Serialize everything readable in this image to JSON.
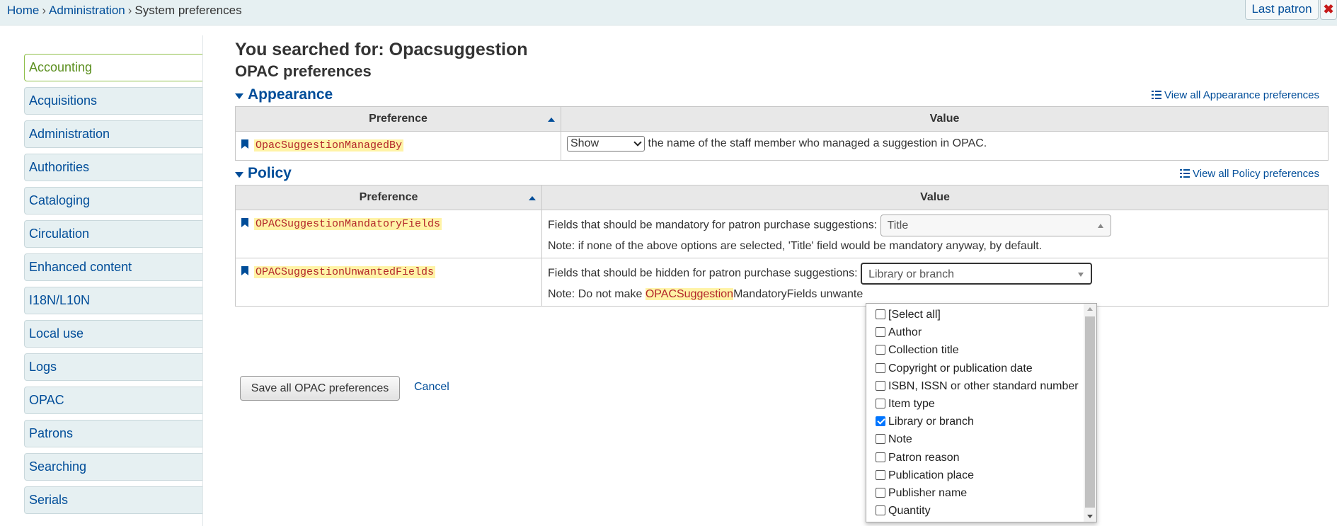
{
  "breadcrumb": {
    "home": "Home",
    "sep1": "›",
    "admin": "Administration",
    "sep2": "›",
    "current": "System preferences"
  },
  "header": {
    "last_patron": "Last patron",
    "close": "✖"
  },
  "sidebar": {
    "items": [
      {
        "label": "Accounting",
        "active": true
      },
      {
        "label": "Acquisitions"
      },
      {
        "label": "Administration"
      },
      {
        "label": "Authorities"
      },
      {
        "label": "Cataloging"
      },
      {
        "label": "Circulation"
      },
      {
        "label": "Enhanced content"
      },
      {
        "label": "I18N/L10N"
      },
      {
        "label": "Local use"
      },
      {
        "label": "Logs"
      },
      {
        "label": "OPAC"
      },
      {
        "label": "Patrons"
      },
      {
        "label": "Searching"
      },
      {
        "label": "Serials"
      }
    ]
  },
  "main": {
    "title": "You searched for: Opacsuggestion",
    "subtitle": "OPAC preferences",
    "appearance": {
      "title": "Appearance",
      "view_all": "View all Appearance preferences",
      "col_pref": "Preference",
      "col_value": "Value",
      "rows": [
        {
          "name": "OpacSuggestionManagedBy",
          "select_value": "Show",
          "text": "the name of the staff member who managed a suggestion in OPAC."
        }
      ]
    },
    "policy": {
      "title": "Policy",
      "view_all": "View all Policy preferences",
      "col_pref": "Preference",
      "col_value": "Value",
      "rows": [
        {
          "name": "OPACSuggestionMandatoryFields",
          "label": "Fields that should be mandatory for patron purchase suggestions:",
          "value": "Title",
          "note": "Note: if none of the above options are selected, 'Title' field would be mandatory anyway, by default."
        },
        {
          "name": "OPACSuggestionUnwantedFields",
          "label": "Fields that should be hidden for patron purchase suggestions:",
          "value": "Library or branch",
          "note_prefix": "Note: Do not make ",
          "note_hl": "OPACSuggestion",
          "note_suffix": "MandatoryFields unwante"
        }
      ]
    },
    "save_label": "Save all OPAC preferences",
    "cancel_label": "Cancel"
  },
  "dropdown": {
    "options": [
      {
        "label": "[Select all]",
        "checked": false
      },
      {
        "label": "Author",
        "checked": false
      },
      {
        "label": "Collection title",
        "checked": false
      },
      {
        "label": "Copyright or publication date",
        "checked": false
      },
      {
        "label": "ISBN, ISSN or other standard number",
        "checked": false
      },
      {
        "label": "Item type",
        "checked": false
      },
      {
        "label": "Library or branch",
        "checked": true
      },
      {
        "label": "Note",
        "checked": false
      },
      {
        "label": "Patron reason",
        "checked": false
      },
      {
        "label": "Publication place",
        "checked": false
      },
      {
        "label": "Publisher name",
        "checked": false
      },
      {
        "label": "Quantity",
        "checked": false
      }
    ]
  },
  "colors": {
    "link": "#004d99",
    "pref_name": "#b3262a",
    "highlight": "#fff3a6",
    "active_tab": "#5b8f1f"
  }
}
